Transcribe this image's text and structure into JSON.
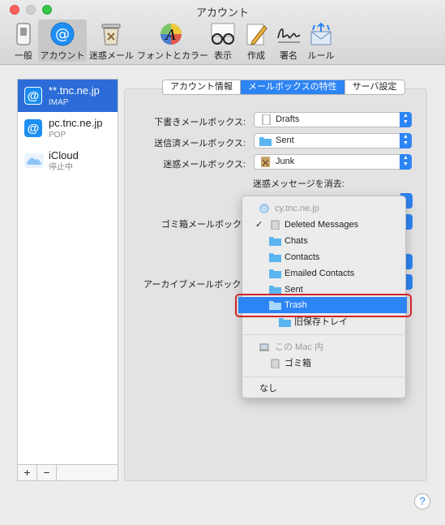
{
  "window": {
    "title": "アカウント"
  },
  "toolbar": {
    "items": [
      {
        "label": "一般",
        "icon": "general-switch-icon"
      },
      {
        "label": "アカウント",
        "icon": "at-sign-icon",
        "selected": true
      },
      {
        "label": "迷惑メール",
        "icon": "junk-trash-icon"
      },
      {
        "label": "フォントとカラー",
        "icon": "font-color-icon"
      },
      {
        "label": "表示",
        "icon": "glasses-icon"
      },
      {
        "label": "作成",
        "icon": "compose-pencil-icon"
      },
      {
        "label": "署名",
        "icon": "signature-icon"
      },
      {
        "label": "ルール",
        "icon": "rules-envelope-icon"
      }
    ]
  },
  "accounts": [
    {
      "name": "**.tnc.ne.jp",
      "type": "IMAP",
      "selected": true
    },
    {
      "name": "pc.tnc.ne.jp",
      "type": "POP"
    },
    {
      "name": "iCloud",
      "type": "停止中"
    }
  ],
  "account_buttons": {
    "add": "+",
    "remove": "−"
  },
  "tabs": [
    {
      "label": "アカウント情報"
    },
    {
      "label": "メールボックスの特性",
      "active": true
    },
    {
      "label": "サーバ設定"
    }
  ],
  "settings": {
    "drafts_label": "下書きメールボックス:",
    "drafts_value": "Drafts",
    "sent_label": "送信済メールボックス:",
    "sent_value": "Sent",
    "junk_label": "迷惑メールボックス:",
    "junk_value": "Junk",
    "erase_junk_label": "迷惑メッセージを消去:",
    "trash_label": "ゴミ箱メールボックス:",
    "archive_label": "アーカイブメールボックス:"
  },
  "menu": {
    "server_header": "cy.tnc.ne.jp",
    "items": [
      {
        "label": "Deleted Messages",
        "checked": true
      },
      {
        "label": "Chats"
      },
      {
        "label": "Contacts"
      },
      {
        "label": "Emailed Contacts"
      },
      {
        "label": "Sent"
      },
      {
        "label": "Trash",
        "highlighted": true
      },
      {
        "label": "旧保存トレイ"
      }
    ],
    "local_header": "この Mac 内",
    "local_items": [
      {
        "label": "ゴミ箱"
      }
    ],
    "none_label": "なし"
  },
  "help": {
    "label": "?"
  },
  "colors": {
    "accent": "#2d84f4",
    "selection": "#2c6cd8",
    "highlight_box": "#d0252a"
  }
}
